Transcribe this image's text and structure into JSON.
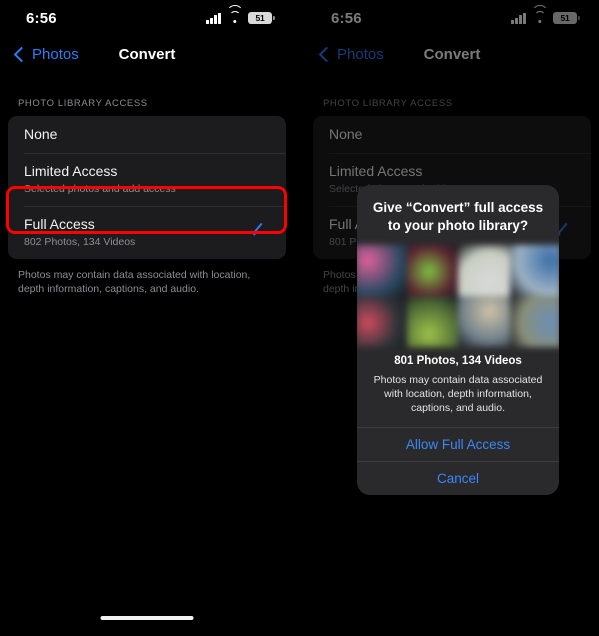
{
  "screens": [
    {
      "id": "list-screen",
      "status_bar": {
        "time": "6:56",
        "cellular_icon": "signal-bars-icon",
        "wifi_icon": "wifi-icon",
        "battery_level": "51"
      },
      "nav": {
        "back_label": "Photos",
        "back_icon": "chevron-left-icon",
        "title": "Convert"
      },
      "section": {
        "header": "PHOTO LIBRARY ACCESS",
        "rows": [
          {
            "title": "None",
            "subtitle": "",
            "selected": false
          },
          {
            "title": "Limited Access",
            "subtitle": "Selected photos and add access",
            "selected": false
          },
          {
            "title": "Full Access",
            "subtitle": "802 Photos, 134 Videos",
            "selected": true,
            "check_icon": "checkmark-icon"
          }
        ],
        "footnote": "Photos may contain data associated with location, depth information, captions, and audio."
      },
      "home_indicator": true,
      "highlight": {
        "target": "full-access-row",
        "color": "#fe0000"
      }
    },
    {
      "id": "dialog-screen",
      "status_bar": {
        "time": "6:56",
        "cellular_icon": "signal-bars-icon",
        "wifi_icon": "wifi-icon",
        "battery_level": "51"
      },
      "nav": {
        "back_label": "Photos",
        "back_icon": "chevron-left-icon",
        "title": "Convert"
      },
      "section": {
        "header": "PHOTO LIBRARY ACCESS",
        "rows": [
          {
            "title": "None",
            "subtitle": "",
            "selected": false
          },
          {
            "title": "Limited Access",
            "subtitle": "Selected photos and add access",
            "selected": false
          },
          {
            "title": "Full Access",
            "subtitle": "801 Photos, 134 Videos",
            "selected": true,
            "check_icon": "checkmark-icon"
          }
        ],
        "footnote": "Photos may contain data associated with location, depth information, captions, and audio."
      },
      "home_indicator": false,
      "dialog": {
        "title": "Give “Convert” full access to your photo library?",
        "preview_icon": "photo-grid-thumbnails",
        "count": "801 Photos, 134 Videos",
        "description": "Photos may contain data associated with location, depth information, captions, and audio.",
        "primary_button": "Allow Full Access",
        "secondary_button": "Cancel"
      },
      "highlight": {
        "target": "allow-full-access-button",
        "color": "#fe0000"
      }
    }
  ],
  "theme": {
    "accent_blue": "#2d7cf6",
    "dialog_blue": "#3b87f7",
    "highlight_red": "#fe0000",
    "list_bg": "#1c1c1e",
    "page_bg": "#000000"
  },
  "photo_grid_colors": [
    "#2b4a63",
    "#5e2732",
    "#c9cfc4",
    "#9fb3c4",
    "#30343a",
    "#4f6b35",
    "#6f7f8a",
    "#8a8f79"
  ]
}
